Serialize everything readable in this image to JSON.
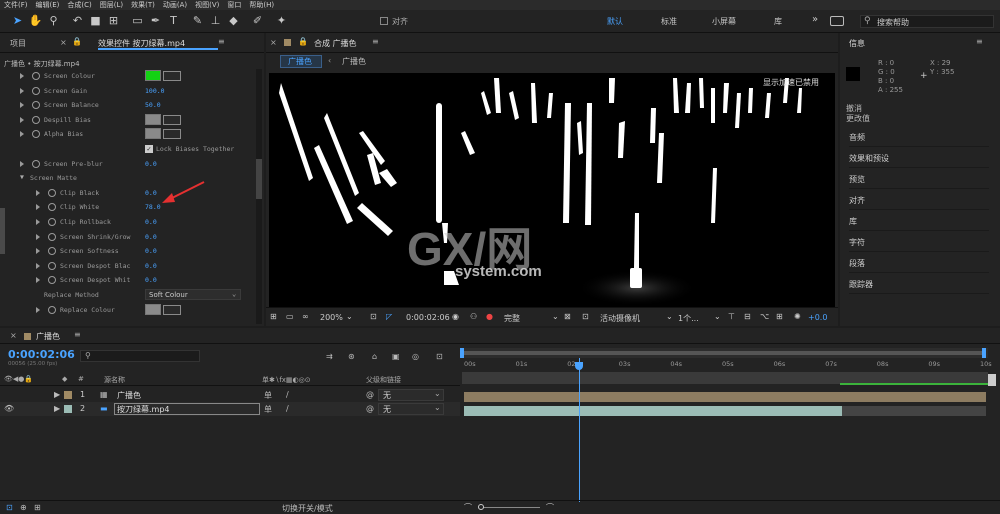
{
  "menu": [
    "文件(F)",
    "编辑(E)",
    "合成(C)",
    "图层(L)",
    "效果(T)",
    "动画(A)",
    "视图(V)",
    "窗口",
    "帮助(H)"
  ],
  "toolbar": {
    "snap_label": "对齐",
    "workspaces": [
      "默认",
      "标准",
      "小屏幕",
      "库"
    ],
    "active_workspace": "默认",
    "more": "»",
    "search_placeholder": "搜索帮助"
  },
  "effects_panel": {
    "tab_project": "项目",
    "tab_effects": "效果控件 按刀绿幕.mp4",
    "breadcrumb": "广播色 • 按刀绿幕.mp4",
    "props": [
      {
        "label": "Screen Colour",
        "value": "",
        "type": "color"
      },
      {
        "label": "Screen Gain",
        "value": "100.0"
      },
      {
        "label": "Screen Balance",
        "value": "50.0"
      },
      {
        "label": "Despill Bias",
        "value": "",
        "type": "color-grey"
      },
      {
        "label": "Alpha Bias",
        "value": "",
        "type": "color-grey"
      },
      {
        "label": "Lock Biases Together",
        "value": "",
        "type": "checkbox"
      },
      {
        "label": "Screen Pre-blur",
        "value": "0.0"
      },
      {
        "label": "Screen Matte",
        "value": "",
        "type": "group"
      },
      {
        "label": "Clip Black",
        "value": "0.0"
      },
      {
        "label": "Clip White",
        "value": "78.0"
      },
      {
        "label": "Clip Rollback",
        "value": "0.0"
      },
      {
        "label": "Screen Shrink/Grow",
        "value": "0.0"
      },
      {
        "label": "Screen Softness",
        "value": "0.0"
      },
      {
        "label": "Screen Despot Blac",
        "value": "0.0"
      },
      {
        "label": "Screen Despot Whit",
        "value": "0.0"
      },
      {
        "label": "Replace Method",
        "value": "Soft Colour",
        "type": "dropdown"
      },
      {
        "label": "Replace Colour",
        "value": "",
        "type": "color-grey"
      }
    ]
  },
  "composition": {
    "title": "合成 广播色",
    "tab_active": "广播色",
    "tab_second": "广播色",
    "overlay": "显示加速已禁用",
    "zoom": "200%",
    "timecode": "0:00:02:06",
    "quality": "完整",
    "camera": "活动摄像机",
    "views": "1个...",
    "exposure": "+0.0",
    "watermark_main": "GX/网",
    "watermark_sub": "system.com"
  },
  "info_panel": {
    "title": "信息",
    "r": "R : 0",
    "g": "G : 0",
    "b": "B : 0",
    "a": "A : 255",
    "x": "X : 29",
    "y": "Y : 355",
    "undo": "撤消",
    "undo_sub": "更改值",
    "items": [
      "音频",
      "效果和预设",
      "预览",
      "对齐",
      "库",
      "字符",
      "段落",
      "跟踪器"
    ]
  },
  "timeline": {
    "comp_name": "广播色",
    "timecode": "0:00:02:06",
    "timecode_sub": "00056 (25.00 fps)",
    "search_placeholder": "",
    "col_source": "源名称",
    "col_parent": "父级和链接",
    "rows": [
      {
        "num": "1",
        "name": "广播色",
        "parent": "无"
      },
      {
        "num": "2",
        "name": "按刀绿幕.mp4",
        "parent": "无"
      }
    ],
    "ticks": [
      "00s",
      "01s",
      "02s",
      "03s",
      "04s",
      "05s",
      "06s",
      "07s",
      "08s",
      "09s",
      "10s"
    ],
    "bottom_label": "切换开关/模式"
  }
}
